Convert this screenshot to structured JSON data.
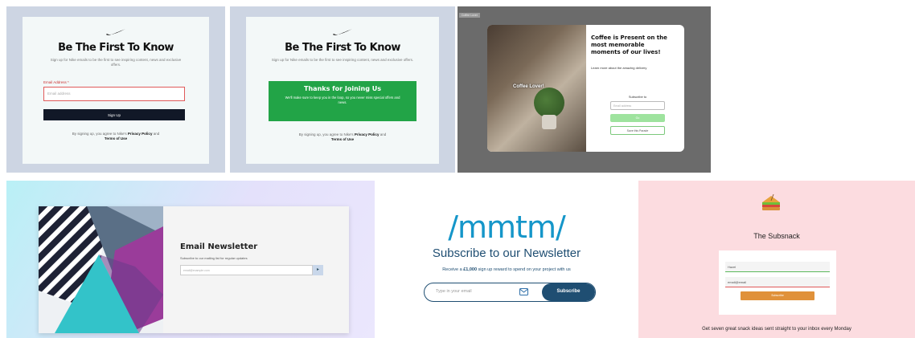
{
  "panels": {
    "nike_signup": {
      "title": "Be The First To Know",
      "subtitle": "Sign up for Nike emails to be the first to see inspiring content, news and exclusive offers.",
      "email_label": "Email Address *",
      "email_placeholder": "Email address",
      "button_label": "Sign Up",
      "legal_prefix": "By signing up, you agree to Nike's",
      "privacy_link": "Privacy Policy",
      "legal_and": "and",
      "terms_link": "Terms of Use"
    },
    "nike_success": {
      "title": "Be The First To Know",
      "subtitle": "Sign up for Nike emails to be the first to see inspiring content, news and exclusive offers.",
      "success_title": "Thanks for Joining Us",
      "success_body": "We'll make sure to keep you in the loop, so you never miss special offers and news.",
      "legal_prefix": "By signing up, you agree to Nike's",
      "privacy_link": "Privacy Policy",
      "legal_and": "and",
      "terms_link": "Terms of Use"
    },
    "coffee": {
      "tab_label": "Coffee Lover",
      "image_caption": "Coffee Lover!",
      "title": "Coffee is Present on the most memorable moments of our lives!",
      "description": "Learn more about the amazing delivery",
      "subscribe_label": "Subscribe to",
      "input_placeholder": "Email address",
      "primary_button": "Go",
      "secondary_button": "Save this Parade"
    },
    "email_newsletter": {
      "title": "Email Newsletter",
      "subtitle": "Subscribe to our mailing list for regular updates",
      "input_placeholder": "email@example.com",
      "submit_icon": "arrow-right-icon"
    },
    "mmtm": {
      "logo": "/mmtm/",
      "title": "Subscribe to our Newsletter",
      "subtitle_prefix": "Receive a",
      "subtitle_amount": "£1,000",
      "subtitle_suffix": "sign up reward to spend on your project with us",
      "input_placeholder": "Type in your email",
      "button_label": "Subscribe",
      "input_icon": "email-icon"
    },
    "subsnack": {
      "logo_icon": "sandwich-icon",
      "title": "The Subsnack",
      "name_value": "Hazel",
      "email_value": "email@email",
      "button_label": "Subscribe",
      "footer": "Get seven great snack ideas sent straight to your inbox every Monday"
    }
  },
  "colors": {
    "nike_bg": "#cdd5e3",
    "nike_button": "#111827",
    "success_green": "#22a447",
    "mmtm_blue": "#1596c9",
    "mmtm_navy": "#1f4e72",
    "snack_pink": "#fcdce0",
    "snack_orange": "#e0913a"
  }
}
